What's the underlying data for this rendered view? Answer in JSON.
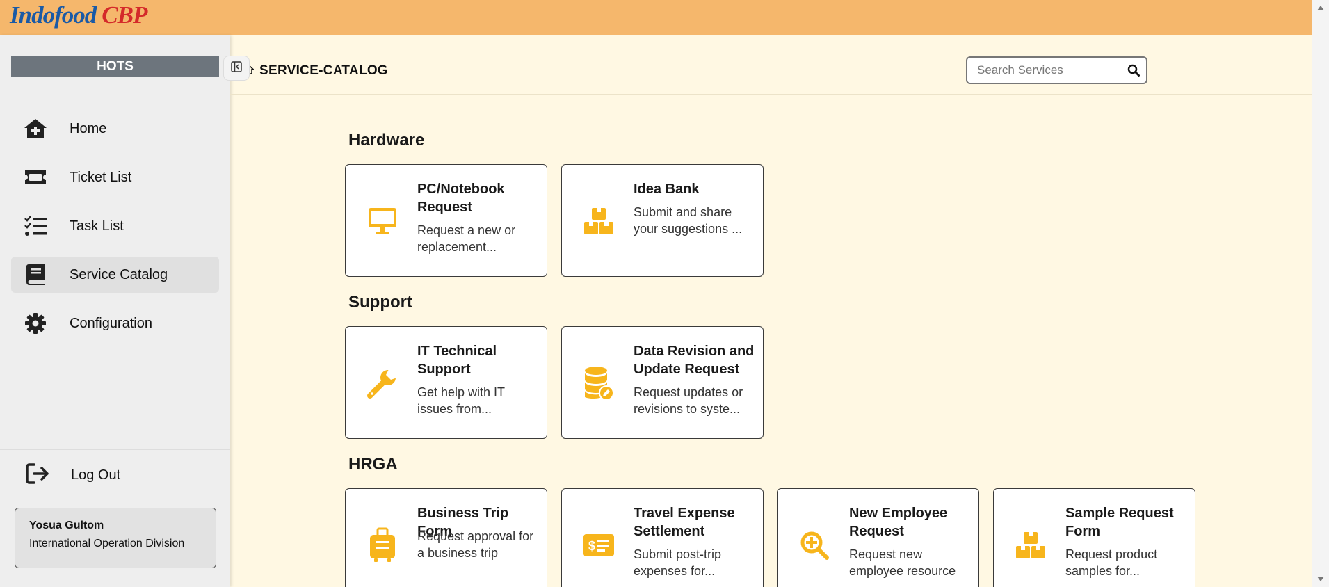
{
  "brand": {
    "part1": "Indofood",
    "part2": "CBP"
  },
  "sidebar": {
    "header": "HOTS",
    "items": [
      {
        "label": "Home",
        "icon": "home-icon"
      },
      {
        "label": "Ticket List",
        "icon": "ticket-icon"
      },
      {
        "label": "Task List",
        "icon": "task-list-icon"
      },
      {
        "label": "Service Catalog",
        "icon": "book-icon",
        "active": true
      },
      {
        "label": "Configuration",
        "icon": "gear-icon"
      }
    ],
    "logout_label": "Log Out",
    "user": {
      "name": "Yosua Gultom",
      "division": "International Operation Division"
    }
  },
  "header": {
    "breadcrumb": "SERVICE-CATALOG",
    "search_placeholder": "Search Services"
  },
  "sections": [
    {
      "title": "Hardware",
      "cards": [
        {
          "title": "PC/Notebook Request",
          "desc": "Request a new or replacement...",
          "icon": "monitor-icon"
        },
        {
          "title": "Idea Bank",
          "desc": "Submit and share your suggestions ...",
          "icon": "boxes-icon"
        }
      ]
    },
    {
      "title": "Support",
      "cards": [
        {
          "title": "IT Technical Support",
          "desc": "Get help with IT issues from...",
          "icon": "wrench-icon"
        },
        {
          "title": "Data Revision and Update Request",
          "desc": "Request updates or revisions to syste...",
          "icon": "database-edit-icon"
        }
      ]
    },
    {
      "title": "HRGA",
      "cards": [
        {
          "title": "Business Trip Form",
          "desc": "Request approval for a business trip",
          "icon": "suitcase-icon"
        },
        {
          "title": "Travel Expense Settlement",
          "desc": "Submit post-trip expenses for...",
          "icon": "money-check-icon"
        },
        {
          "title": "New Employee Request",
          "desc": "Request new employee resource",
          "icon": "search-plus-icon"
        },
        {
          "title": "Sample Request Form",
          "desc": "Request product samples for...",
          "icon": "boxes-icon"
        }
      ]
    }
  ],
  "colors": {
    "topbar": "#f5b76c",
    "accent": "#f7b51c",
    "background": "#fff8e3",
    "sidebar": "#eeeeee"
  }
}
